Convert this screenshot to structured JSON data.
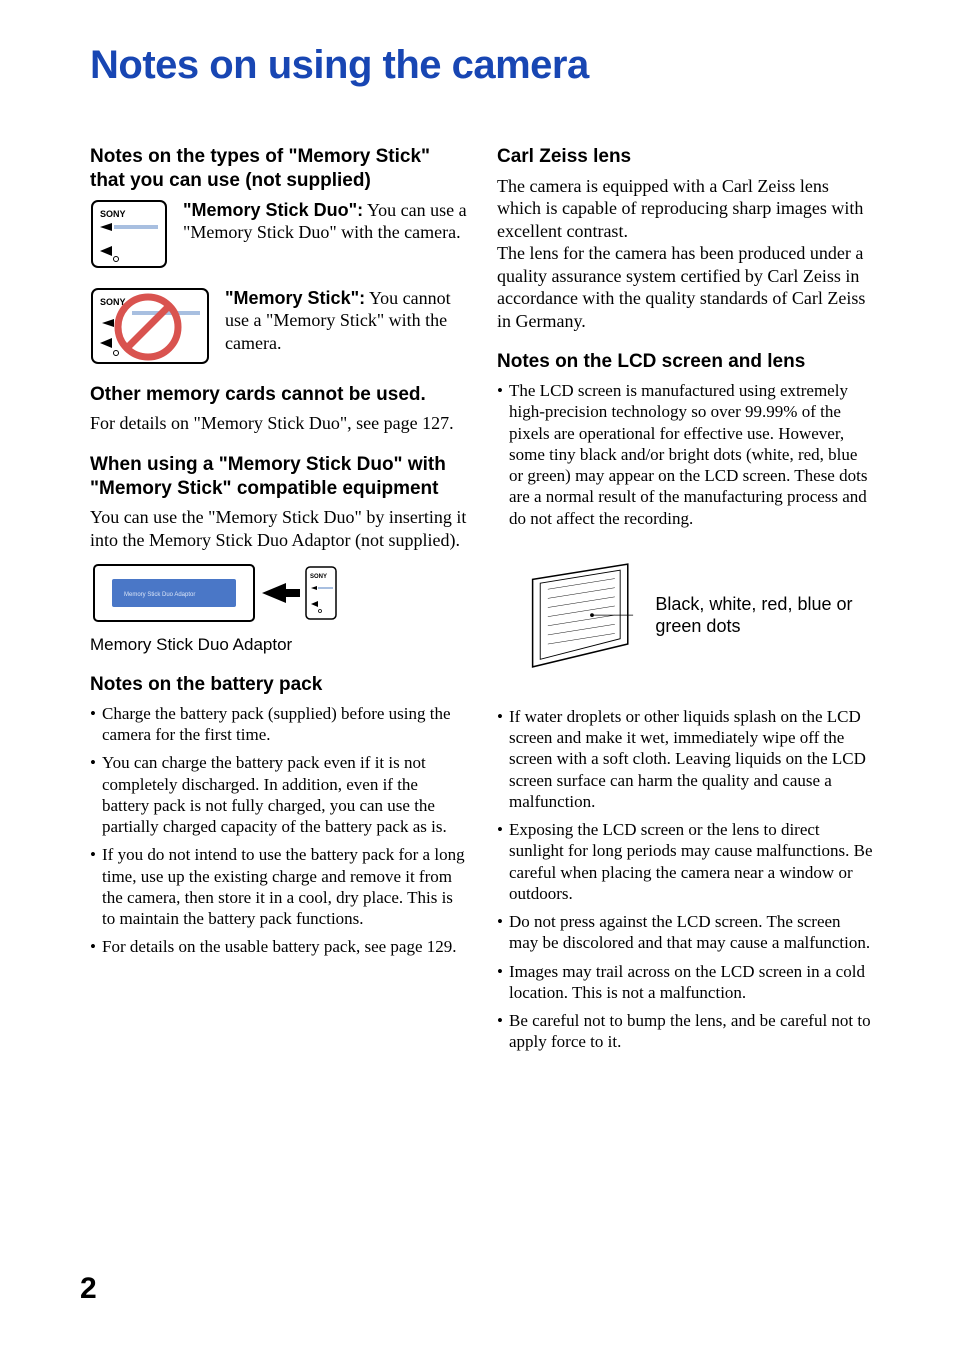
{
  "title": "Notes on using the camera",
  "left": {
    "h1": "Notes on the types of \"Memory Stick\" that you can use (not supplied)",
    "duo_lead": "\"Memory Stick Duo\":",
    "duo_body": "You can use a \"Memory Stick Duo\" with the camera.",
    "std_lead": "\"Memory Stick\":",
    "std_body": "You cannot use a \"Memory Stick\" with the camera.",
    "h2": "Other memory cards cannot be used.",
    "h2_body": "For details on \"Memory Stick Duo\", see page 127.",
    "h3": "When using a \"Memory Stick Duo\" with \"Memory Stick\" compatible equipment",
    "h3_body": "You can use the \"Memory Stick Duo\" by inserting it into the Memory Stick Duo Adaptor (not supplied).",
    "adaptor_label_inner": "Memory Stick Duo Adaptor",
    "adaptor_caption": "Memory Stick Duo Adaptor",
    "h4": "Notes on the battery pack",
    "battery": [
      "Charge the battery pack (supplied) before using the camera for the first time.",
      "You can charge the battery pack even if it is not completely discharged. In addition, even if the battery pack is not fully charged, you can use the partially charged capacity of the battery pack as is.",
      "If you do not intend to use the battery pack for a long time, use up the existing charge and remove it from the camera, then store it in a cool, dry place. This is to maintain the battery pack functions.",
      "For details on the usable battery pack, see page 129."
    ]
  },
  "right": {
    "h1": "Carl Zeiss lens",
    "h1_body1": "The camera is equipped with a Carl Zeiss lens which is capable of reproducing sharp images with excellent contrast.",
    "h1_body2": "The lens for the camera has been produced under a quality assurance system certified by Carl Zeiss in accordance with the quality standards of Carl Zeiss in Germany.",
    "h2": "Notes on the LCD screen and lens",
    "lcd1": "The LCD screen is manufactured using extremely high-precision technology so over 99.99% of the pixels are operational for effective use. However, some tiny black and/or bright dots (white, red, blue or green) may appear on the LCD screen. These dots are a normal result of the manufacturing process and do not affect the recording.",
    "lcd_fig_label": "Black, white, red, blue or green dots",
    "lcd_rest": [
      "If water droplets or other liquids splash on the LCD screen and make it wet, immediately wipe off the screen with a soft cloth. Leaving liquids on the LCD screen surface can harm the quality and cause a malfunction.",
      "Exposing the LCD screen or the lens to direct sunlight for long periods may cause malfunctions. Be careful when placing the camera near a window or outdoors.",
      "Do not press against the LCD screen. The screen may be discolored and that may cause a malfunction.",
      "Images may trail across on the LCD screen in a cold location. This is not a malfunction.",
      "Be careful not to bump the lens, and be careful not to apply force to it."
    ]
  },
  "page_number": "2",
  "icons": {
    "sony": "SONY"
  }
}
